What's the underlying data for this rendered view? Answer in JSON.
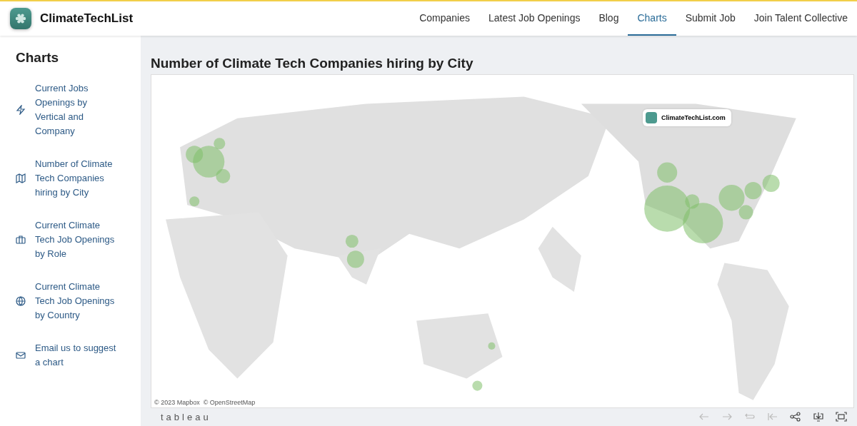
{
  "header": {
    "brand": "ClimateTechList",
    "nav": [
      {
        "label": "Companies",
        "selected": false
      },
      {
        "label": "Latest Job Openings",
        "selected": false
      },
      {
        "label": "Blog",
        "selected": false
      },
      {
        "label": "Charts",
        "selected": true
      },
      {
        "label": "Submit Job",
        "selected": false
      },
      {
        "label": "Join Talent Collective",
        "selected": false
      }
    ]
  },
  "sidebar": {
    "title": "Charts",
    "items": [
      {
        "label": "Current Jobs Openings by Vertical and Company"
      },
      {
        "label": "Number of Climate Tech Companies hiring by City"
      },
      {
        "label": "Current Climate Tech Job Openings by Role"
      },
      {
        "label": "Current Climate Tech Job Openings by Country"
      },
      {
        "label": "Email us to suggest a chart"
      }
    ]
  },
  "main": {
    "title": "Number of Climate Tech Companies hiring by City",
    "map": {
      "kind": "picture",
      "badge": "ClimateTechList.com",
      "attribution": "© 2023 Mapbox  © OpenStreetMap"
    },
    "toolbar": {
      "logo": "tableau",
      "buttons": [
        {
          "disabled": true
        },
        {
          "disabled": true
        },
        {
          "disabled": true
        },
        {
          "disabled": true
        },
        {
          "disabled": false
        },
        {
          "disabled": false
        },
        {
          "disabled": false
        }
      ]
    }
  }
}
